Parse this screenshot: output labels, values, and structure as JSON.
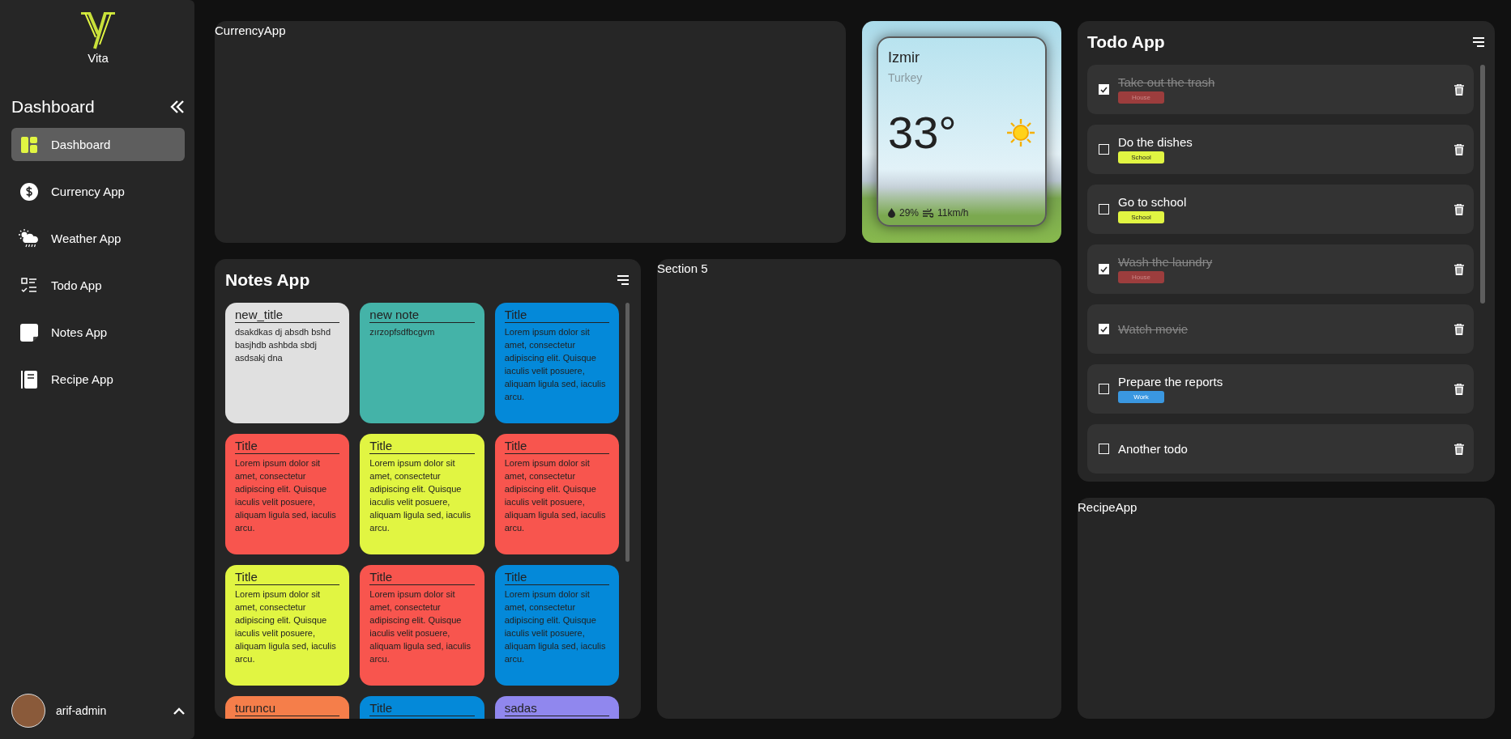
{
  "sidebar": {
    "logo_text": "Vita",
    "heading": "Dashboard",
    "items": [
      {
        "label": "Dashboard",
        "selected": true
      },
      {
        "label": "Currency App",
        "selected": false
      },
      {
        "label": "Weather App",
        "selected": false
      },
      {
        "label": "Todo App",
        "selected": false
      },
      {
        "label": "Notes App",
        "selected": false
      },
      {
        "label": "Recipe App",
        "selected": false
      }
    ],
    "user": {
      "name": "arif-admin"
    }
  },
  "currency_app": {
    "title": "CurrencyApp"
  },
  "weather": {
    "city": "Izmir",
    "country": "Turkey",
    "temperature": "33°",
    "humidity": "29%",
    "wind": "11km/h"
  },
  "notes_app": {
    "title": "Notes App",
    "notes": [
      {
        "title": "new_title",
        "body": "dsakdkas dj absdh bshd basjhdb ashbda sbdj asdsakj dna",
        "color": "#e0e0e0"
      },
      {
        "title": "new note",
        "body": "zırzopfsdfbcgvm",
        "color": "#44b3a8"
      },
      {
        "title": "Title",
        "body": "Lorem ipsum dolor sit amet, consectetur adipiscing elit. Quisque iaculis velit posuere, aliquam ligula sed, iaculis arcu.",
        "color": "#0489d9"
      },
      {
        "title": "Title",
        "body": "Lorem ipsum dolor sit amet, consectetur adipiscing elit. Quisque iaculis velit posuere, aliquam ligula sed, iaculis arcu.",
        "color": "#f8554e"
      },
      {
        "title": "Title",
        "body": "Lorem ipsum dolor sit amet, consectetur adipiscing elit. Quisque iaculis velit posuere, aliquam ligula sed, iaculis arcu.",
        "color": "#e1f542"
      },
      {
        "title": "Title",
        "body": "Lorem ipsum dolor sit amet, consectetur adipiscing elit. Quisque iaculis velit posuere, aliquam ligula sed, iaculis arcu.",
        "color": "#f8554e"
      },
      {
        "title": "Title",
        "body": "Lorem ipsum dolor sit amet, consectetur adipiscing elit. Quisque iaculis velit posuere, aliquam ligula sed, iaculis arcu.",
        "color": "#e1f542"
      },
      {
        "title": "Title",
        "body": "Lorem ipsum dolor sit amet, consectetur adipiscing elit. Quisque iaculis velit posuere, aliquam ligula sed, iaculis arcu.",
        "color": "#f8554e"
      },
      {
        "title": "Title",
        "body": "Lorem ipsum dolor sit amet, consectetur adipiscing elit. Quisque iaculis velit posuere, aliquam ligula sed, iaculis arcu.",
        "color": "#0489d9"
      },
      {
        "title": "turuncu",
        "color": "#f57e4a"
      },
      {
        "title": "Title",
        "color": "#0489d9"
      },
      {
        "title": "sadas",
        "color": "#9087ee"
      }
    ]
  },
  "section_5": {
    "title": "Section 5"
  },
  "todo_app": {
    "title": "Todo App",
    "todos": [
      {
        "text": "Take out the trash",
        "checked": true,
        "tag": {
          "label": "House",
          "color": "#9c3d3d"
        }
      },
      {
        "text": "Do the dishes",
        "checked": false,
        "tag": {
          "label": "School",
          "color": "#e1f542"
        }
      },
      {
        "text": "Go to school",
        "checked": false,
        "tag": {
          "label": "School",
          "color": "#e1f542"
        }
      },
      {
        "text": "Wash the laundry",
        "checked": true,
        "tag": {
          "label": "House",
          "color": "#9c3d3d"
        }
      },
      {
        "text": "Watch movie",
        "checked": true
      },
      {
        "text": "Prepare the reports",
        "checked": false,
        "tag": {
          "label": "Work",
          "color": "#3a97e0"
        }
      },
      {
        "text": "Another todo",
        "checked": false
      }
    ]
  },
  "recipe_app": {
    "title": "RecipeApp"
  }
}
